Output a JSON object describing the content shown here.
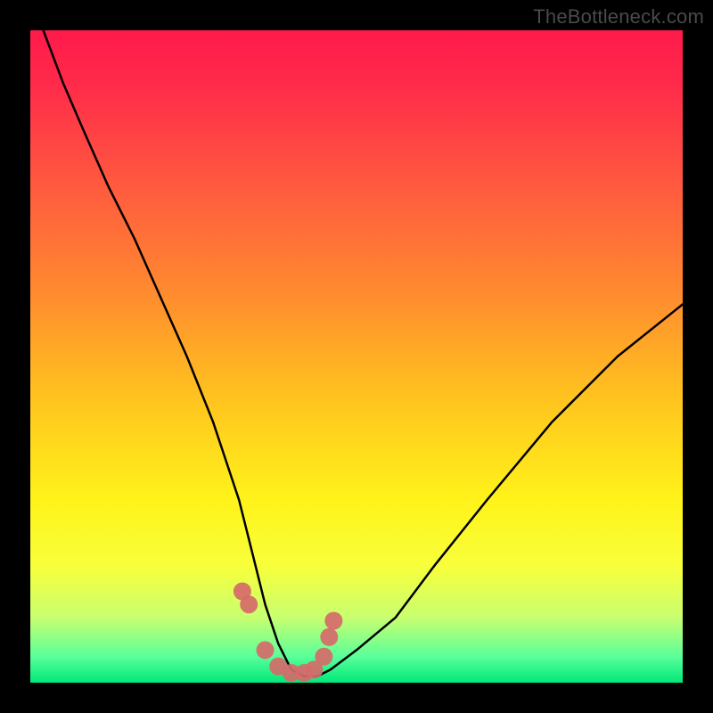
{
  "watermark": "TheBottleneck.com",
  "chart_data": {
    "type": "line",
    "title": "",
    "xlabel": "",
    "ylabel": "",
    "xlim": [
      0,
      100
    ],
    "ylim": [
      0,
      100
    ],
    "series": [
      {
        "name": "bottleneck-curve",
        "x": [
          2,
          5,
          8,
          12,
          16,
          20,
          24,
          28,
          32,
          34,
          36,
          38,
          40,
          42,
          44,
          46,
          50,
          56,
          62,
          70,
          80,
          90,
          100
        ],
        "values": [
          100,
          92,
          85,
          76,
          68,
          59,
          50,
          40,
          28,
          20,
          12,
          6,
          2,
          1,
          1,
          2,
          5,
          10,
          18,
          28,
          40,
          50,
          58
        ]
      }
    ],
    "markers": {
      "name": "valley-markers",
      "color": "#d66a6a",
      "x": [
        32.5,
        33.5,
        36,
        38,
        40,
        42,
        43.5,
        45,
        45.8,
        46.5
      ],
      "values": [
        14,
        12,
        5,
        2.5,
        1.5,
        1.5,
        2,
        4,
        7,
        9.5
      ]
    },
    "background_gradient": {
      "top": "#ff1a4b",
      "mid": "#fff31a",
      "bottom": "#00e87a"
    }
  }
}
